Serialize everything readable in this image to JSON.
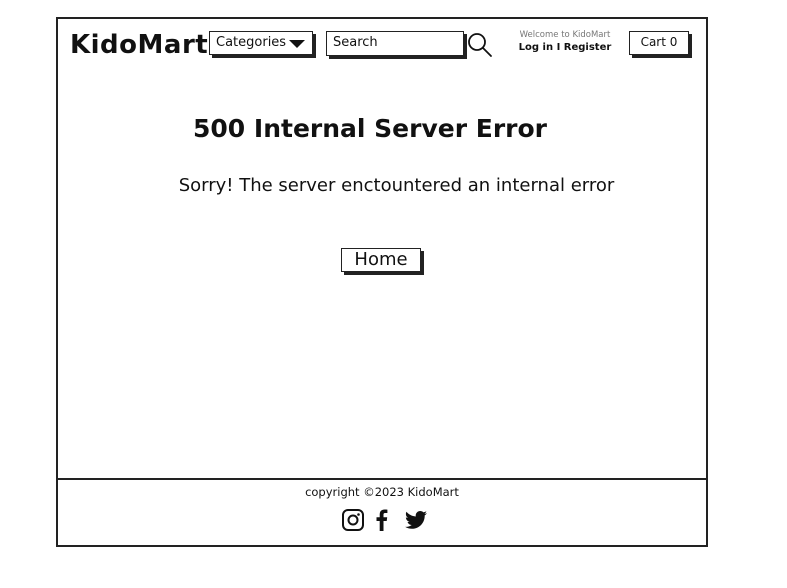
{
  "header": {
    "logo": "KidoMart",
    "categories_label": "Categories",
    "search_placeholder": "Search",
    "welcome_text": "Welcome to KidoMart",
    "login_text": "Log in I Register",
    "cart_label": "Cart 0"
  },
  "main": {
    "title": "500 Internal Server Error",
    "message": "Sorry! The server enctountered an internal error",
    "home_button": "Home"
  },
  "footer": {
    "copyright": "copyright ©2023 KidoMart",
    "social_icons": [
      "instagram-icon",
      "facebook-icon",
      "twitter-icon"
    ]
  }
}
